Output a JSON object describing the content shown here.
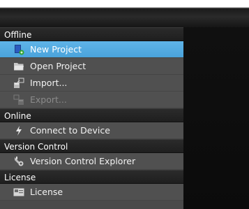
{
  "sections": [
    {
      "header": "Offline",
      "items": [
        {
          "label": "New Project",
          "icon": "new-project-icon",
          "selected": true
        },
        {
          "label": "Open Project",
          "icon": "folder-icon"
        },
        {
          "label": "Import...",
          "icon": "import-icon"
        },
        {
          "label": "Export...",
          "icon": "export-icon",
          "disabled": true
        }
      ]
    },
    {
      "header": "Online",
      "items": [
        {
          "label": "Connect to Device",
          "icon": "lightning-icon"
        }
      ]
    },
    {
      "header": "Version Control",
      "items": [
        {
          "label": "Version Control Explorer",
          "icon": "version-control-icon"
        }
      ]
    },
    {
      "header": "License",
      "items": [
        {
          "label": "License",
          "icon": "license-icon"
        }
      ]
    }
  ],
  "colors": {
    "selected": "#55aee3",
    "panel": "#505050",
    "header": "#252525"
  }
}
